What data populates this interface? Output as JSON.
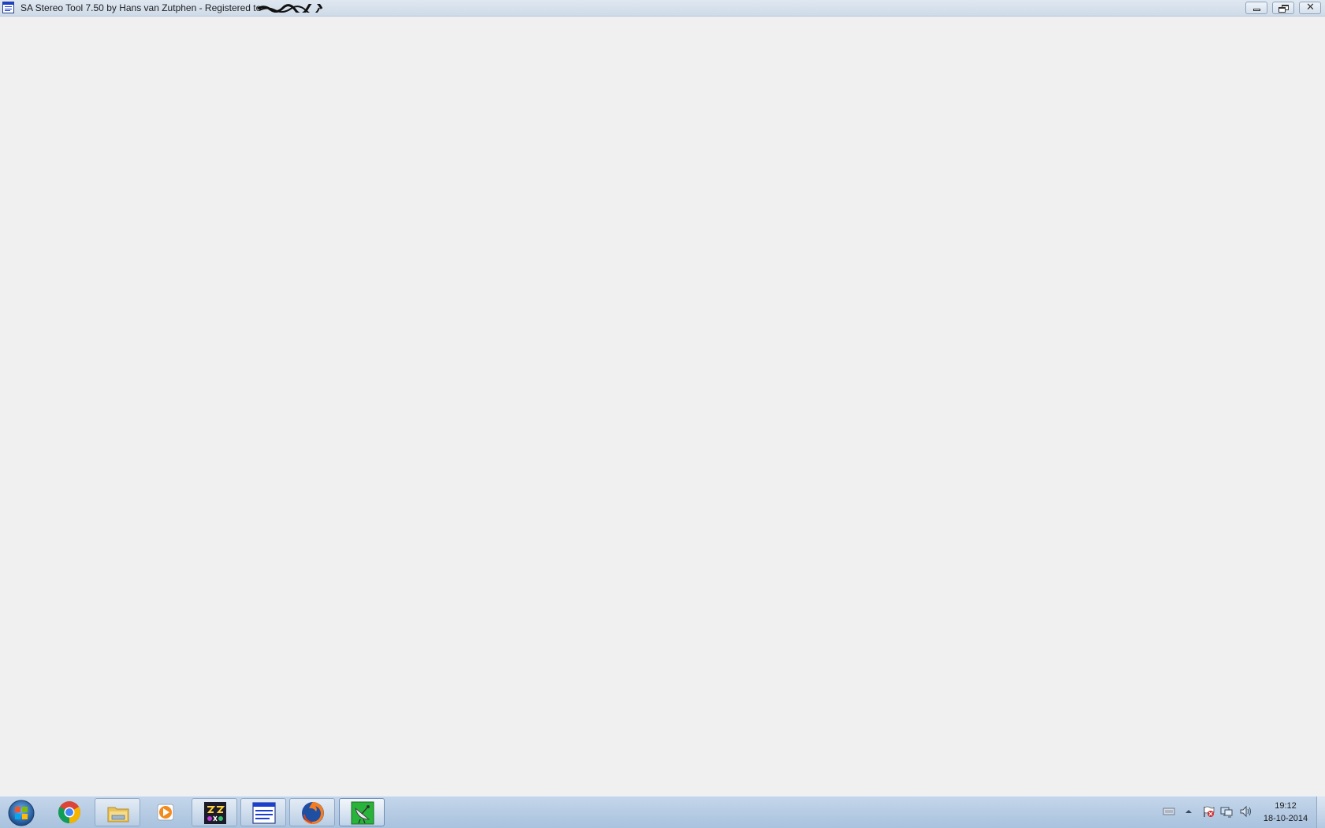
{
  "window": {
    "title": "SA Stereo Tool 7.50 by Hans van Zutphen - Registered to",
    "redacted_name": "[redacted]",
    "buttons": {
      "minimize": "minimize",
      "restore": "restore",
      "close": "close"
    }
  },
  "taskbar": {
    "start": "Start",
    "pinned": [
      {
        "name": "Google Chrome",
        "icon": "chrome-icon",
        "open": false
      },
      {
        "name": "Windows Explorer",
        "icon": "folder-icon",
        "open": true
      },
      {
        "name": "Windows Media Player",
        "icon": "media-player-icon",
        "open": false
      },
      {
        "name": "Application",
        "icon": "app-icon",
        "open": true
      },
      {
        "name": "SA Stereo Tool",
        "icon": "stereo-tool-icon",
        "open": true
      },
      {
        "name": "Mozilla Firefox",
        "icon": "firefox-icon",
        "open": true
      },
      {
        "name": "Satellite app",
        "icon": "satellite-dish-icon",
        "open": true,
        "active": true
      }
    ],
    "tray": {
      "icons": [
        "keyboard-icon",
        "show-hidden-icons-arrow",
        "action-center-flag-icon",
        "network-icon",
        "volume-icon"
      ],
      "time": "19:12",
      "date": "18-10-2014"
    }
  },
  "colors": {
    "client_bg": "#f0f0f0",
    "titlebar_top": "#dfe7f1",
    "taskbar": "#b7cce4"
  }
}
